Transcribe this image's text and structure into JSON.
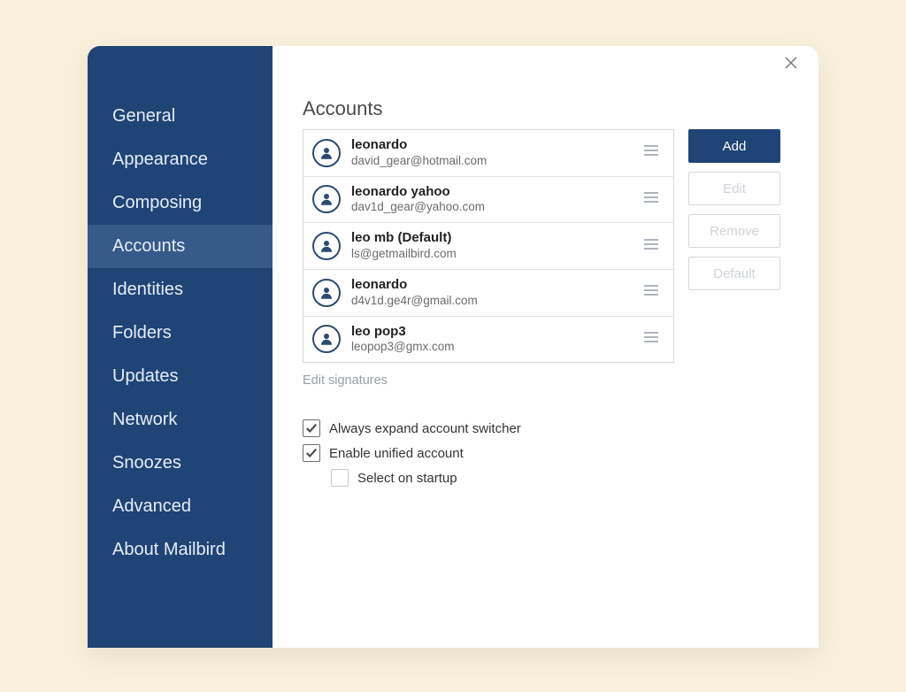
{
  "colors": {
    "sidebar": "#1f4475",
    "accent": "#1f4475"
  },
  "sidebar": {
    "items": [
      {
        "label": "General"
      },
      {
        "label": "Appearance"
      },
      {
        "label": "Composing"
      },
      {
        "label": "Accounts",
        "active": true
      },
      {
        "label": "Identities"
      },
      {
        "label": "Folders"
      },
      {
        "label": "Updates"
      },
      {
        "label": "Network"
      },
      {
        "label": "Snoozes"
      },
      {
        "label": "Advanced"
      },
      {
        "label": "About Mailbird"
      }
    ]
  },
  "main": {
    "title": "Accounts",
    "accounts": [
      {
        "name": "leonardo",
        "email": "david_gear@hotmail.com"
      },
      {
        "name": "leonardo yahoo",
        "email": "dav1d_gear@yahoo.com"
      },
      {
        "name": "leo mb (Default)",
        "email": "ls@getmailbird.com"
      },
      {
        "name": "leonardo",
        "email": "d4v1d.ge4r@gmail.com"
      },
      {
        "name": "leo pop3",
        "email": "leopop3@gmx.com"
      }
    ],
    "buttons": {
      "add": "Add",
      "edit": "Edit",
      "remove": "Remove",
      "default": "Default"
    },
    "edit_signatures": "Edit signatures",
    "options": {
      "always_expand": {
        "label": "Always expand account switcher",
        "checked": true
      },
      "unified": {
        "label": "Enable unified account",
        "checked": true
      },
      "select_startup": {
        "label": "Select on startup",
        "checked": false
      }
    }
  }
}
